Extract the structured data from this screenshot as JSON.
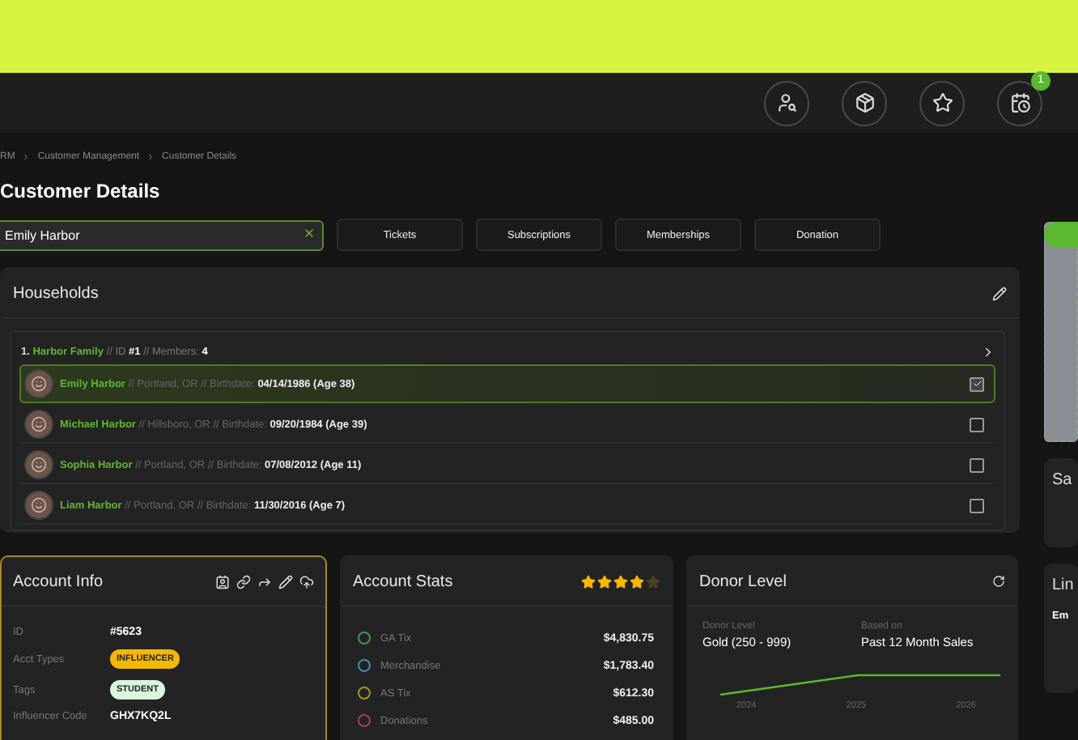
{
  "header": {
    "notification_badge": "1"
  },
  "breadcrumb": [
    "RM",
    "Customer Management",
    "Customer Details"
  ],
  "page_title": "Customer Details",
  "search": {
    "value": "Emily Harbor"
  },
  "tabs": [
    {
      "label": "Tickets",
      "selected": false
    },
    {
      "label": "Subscriptions",
      "selected": false
    },
    {
      "label": "Memberships",
      "selected": false
    },
    {
      "label": "Donation",
      "selected": false
    }
  ],
  "households": {
    "title": "Households",
    "family": {
      "number": "1.",
      "name": "Harbor Family",
      "separator": "//",
      "id_label": "ID",
      "id": "#1",
      "members_label": "Members:",
      "members": "4"
    },
    "members": [
      {
        "name": "Emily Harbor",
        "location": "Portland, OR",
        "birthdate_label": "Birthdate:",
        "birthdate": "04/14/1986 (Age 38)",
        "selected": true
      },
      {
        "name": "Michael Harbor",
        "location": "Hillsboro, OR",
        "birthdate_label": "Birthdate:",
        "birthdate": "09/20/1984 (Age 39)",
        "selected": false
      },
      {
        "name": "Sophia Harbor",
        "location": "Portland, OR",
        "birthdate_label": "Birthdate:",
        "birthdate": "07/08/2012 (Age 11)",
        "selected": false
      },
      {
        "name": "Liam Harbor",
        "location": "Portland, OR",
        "birthdate_label": "Birthdate:",
        "birthdate": "11/30/2016 (Age 7)",
        "selected": false
      }
    ]
  },
  "account_info": {
    "title": "Account Info",
    "fields": [
      {
        "label": "ID",
        "kind": "text",
        "value": "#5623"
      },
      {
        "label": "Acct Types",
        "kind": "badge",
        "value": "INFLUENCER",
        "color": "#f5b800"
      },
      {
        "label": "Tags",
        "kind": "badge",
        "value": "STUDENT",
        "color": "#d9f7dc"
      },
      {
        "label": "Influencer Code",
        "kind": "text",
        "value": "GHX7KQ2L"
      }
    ]
  },
  "account_stats": {
    "title": "Account Stats",
    "stars": 4,
    "rows": [
      {
        "label": "GA Tix",
        "value": "$4,830.75",
        "color": "#3f9a5c"
      },
      {
        "label": "Merchandise",
        "value": "$1,783.40",
        "color": "#3f8fae"
      },
      {
        "label": "AS Tix",
        "value": "$612.30",
        "color": "#a8922e"
      },
      {
        "label": "Donations",
        "value": "$485.00",
        "color": "#a8404f"
      }
    ]
  },
  "donor_level": {
    "title": "Donor Level",
    "level_label": "Donor Level",
    "level_value": "Gold (250 - 999)",
    "basis_label": "Based on",
    "basis_value": "Past 12 Month Sales",
    "axis_labels": [
      "2024",
      "2025",
      "2026"
    ]
  },
  "side": {
    "panel_1_title": "Sa",
    "panel_2_title": "Lin",
    "panel_2_text": "Em"
  }
}
